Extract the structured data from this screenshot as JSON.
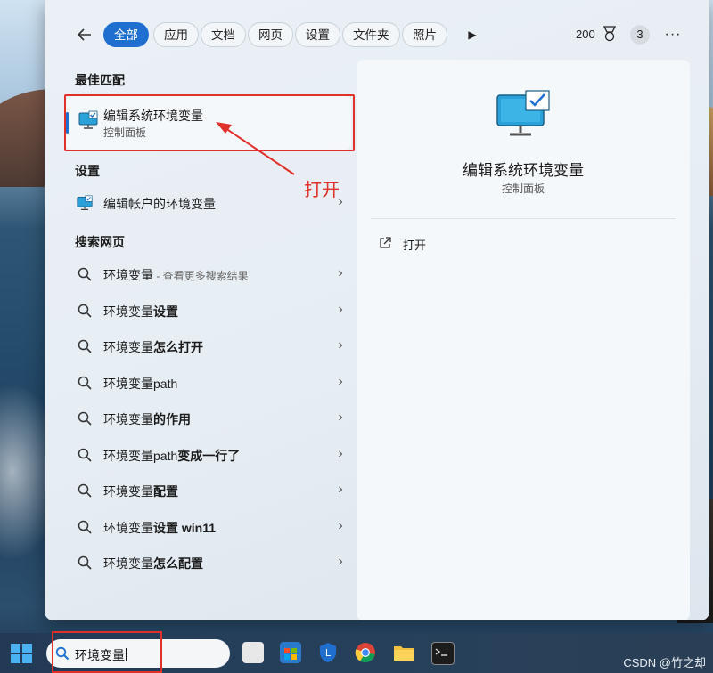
{
  "filters": {
    "tabs": [
      "全部",
      "应用",
      "文档",
      "网页",
      "设置",
      "文件夹",
      "照片"
    ],
    "active_tab": "全部",
    "points": "200",
    "badge_count": "3"
  },
  "best_match": {
    "section_title": "最佳匹配",
    "title": "编辑系统环境变量",
    "subtitle": "控制面板"
  },
  "settings": {
    "section_title": "设置",
    "items": [
      {
        "label": "编辑帐户的环境变量"
      }
    ]
  },
  "web": {
    "section_title": "搜索网页",
    "items": [
      {
        "prefix": "环境变量",
        "bold": "",
        "hint": " - 查看更多搜索结果"
      },
      {
        "prefix": "环境变量",
        "bold": "设置",
        "hint": ""
      },
      {
        "prefix": "环境变量",
        "bold": "怎么打开",
        "hint": ""
      },
      {
        "prefix": "环境变量",
        "bold": "",
        "plain": "path",
        "hint": ""
      },
      {
        "prefix": "环境变量",
        "bold": "的作用",
        "hint": ""
      },
      {
        "prefix": "环境变量",
        "plain": "path",
        "bold": "变成一行了",
        "hint": ""
      },
      {
        "prefix": "环境变量",
        "bold": "配置",
        "hint": ""
      },
      {
        "prefix": "环境变量",
        "bold": "设置 win11",
        "hint": ""
      },
      {
        "prefix": "环境变量",
        "bold": "怎么配置",
        "hint": ""
      }
    ]
  },
  "detail": {
    "title": "编辑系统环境变量",
    "subtitle": "控制面板",
    "open_label": "打开"
  },
  "annotation": {
    "text": "打开"
  },
  "taskbar": {
    "search_query": "环境变量",
    "watermark": "CSDN @竹之却"
  },
  "colors": {
    "accent": "#1f6fd1",
    "annotation_red": "#e0302a"
  }
}
